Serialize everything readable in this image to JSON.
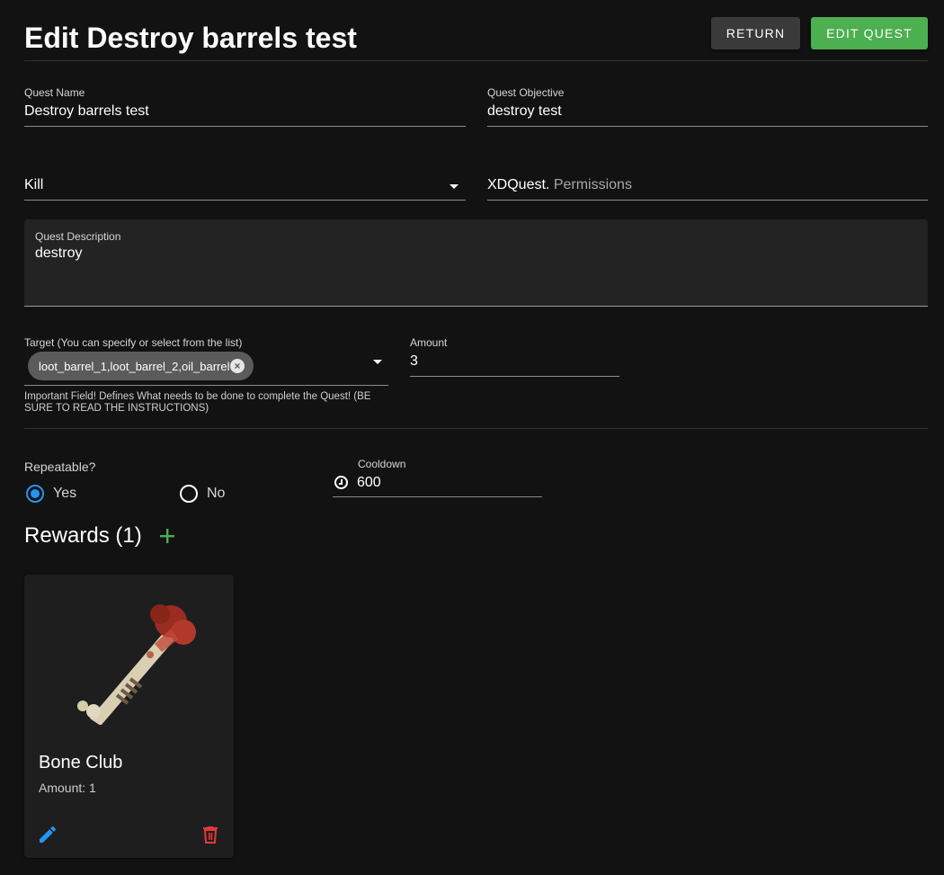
{
  "header": {
    "title": "Edit Destroy barrels test",
    "return_label": "RETURN",
    "edit_label": "EDIT QUEST"
  },
  "form": {
    "quest_name": {
      "label": "Quest Name",
      "value": "Destroy barrels test"
    },
    "quest_objective": {
      "label": "Quest Objective",
      "value": "destroy test"
    },
    "quest_type": {
      "value": "Kill"
    },
    "permission": {
      "prefix": "XDQuest.",
      "placeholder": "Permissions"
    },
    "description": {
      "label": "Quest Description",
      "value": "destroy"
    },
    "target": {
      "label": "Target (You can specify or select from the list)",
      "chip": "loot_barrel_1,loot_barrel_2,oil_barrel",
      "helper": "Important Field! Defines What needs to be done to complete the Quest! (BE SURE TO READ THE INSTRUCTIONS)"
    },
    "amount": {
      "label": "Amount",
      "value": "3"
    },
    "repeatable": {
      "label": "Repeatable?",
      "options": [
        "Yes",
        "No"
      ],
      "selected": "Yes"
    },
    "cooldown": {
      "label": "Cooldown",
      "value": "600"
    }
  },
  "rewards": {
    "title": "Rewards (1)",
    "items": [
      {
        "name": "Bone Club",
        "amount_text": "Amount: 1"
      }
    ]
  },
  "colors": {
    "accent_green": "#4caf50",
    "accent_blue": "#2196f3",
    "delete_red": "#e53935"
  },
  "icons": [
    "plus-icon",
    "pencil-icon",
    "trash-icon",
    "clock-icon",
    "close-circle-icon",
    "caret-down-icon"
  ]
}
